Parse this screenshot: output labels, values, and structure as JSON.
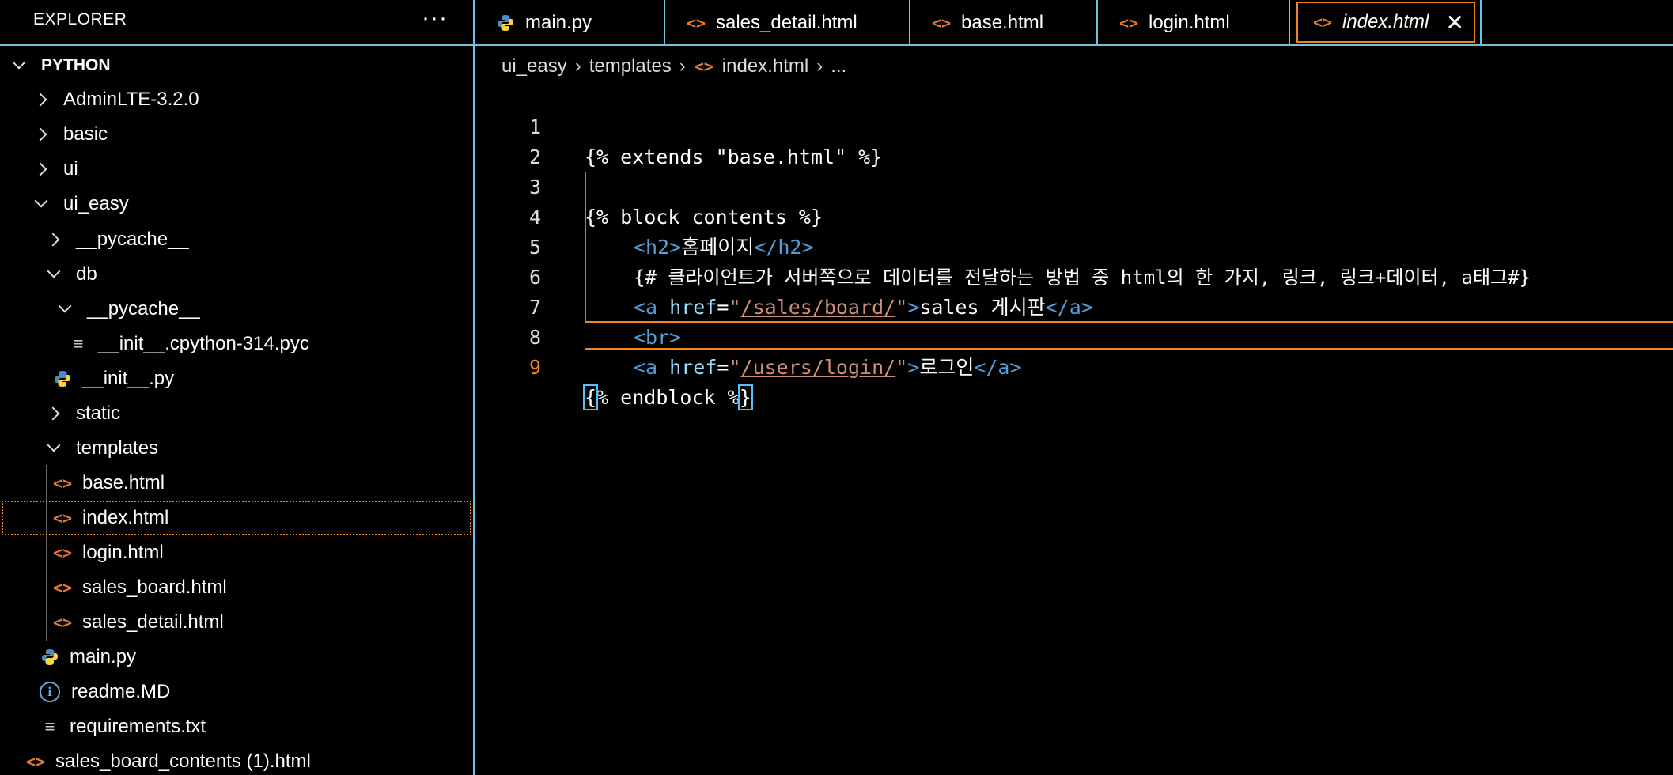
{
  "sidebar": {
    "title": "EXPLORER",
    "more": "···",
    "section": "PYTHON",
    "items": [
      {
        "label": "AdminLTE-3.2.0"
      },
      {
        "label": "basic"
      },
      {
        "label": "ui"
      },
      {
        "label": "ui_easy"
      },
      {
        "label": "__pycache__"
      },
      {
        "label": "db"
      },
      {
        "label": "__pycache__"
      },
      {
        "label": "__init__.cpython-314.pyc"
      },
      {
        "label": "__init__.py"
      },
      {
        "label": "static"
      },
      {
        "label": "templates"
      },
      {
        "label": "base.html"
      },
      {
        "label": "index.html"
      },
      {
        "label": "login.html"
      },
      {
        "label": "sales_board.html"
      },
      {
        "label": "sales_detail.html"
      },
      {
        "label": "main.py"
      },
      {
        "label": "readme.MD"
      },
      {
        "label": "requirements.txt"
      },
      {
        "label": "sales_board_contents (1).html"
      }
    ]
  },
  "tabs": [
    {
      "label": "main.py"
    },
    {
      "label": "sales_detail.html"
    },
    {
      "label": "base.html"
    },
    {
      "label": "login.html"
    },
    {
      "label": "index.html",
      "close": "✕"
    }
  ],
  "breadcrumb": {
    "parts": [
      "ui_easy",
      "templates",
      "index.html",
      "..."
    ]
  },
  "editor": {
    "line_numbers": [
      "1",
      "2",
      "3",
      "4",
      "5",
      "6",
      "7",
      "8",
      "9"
    ],
    "line1": "{% extends \"base.html\" %}",
    "line3": "{% block contents %}",
    "line4": {
      "open": "<h2>",
      "text": "홈페이지",
      "close": "</h2>"
    },
    "line5": "{# 클라이언트가 서버쪽으로 데이터를 전달하는 방법 중 html의 한 가지, 링크, 링크+데이터, a태그#}",
    "line6": {
      "open": "<a",
      "attr": "href",
      "eq": "=",
      "q": "\"",
      "url": "/sales/board/",
      "close_gt": ">",
      "text": "sales 게시판",
      "close": "</a>"
    },
    "line7": "<br>",
    "line8": {
      "open": "<a",
      "attr": "href",
      "eq": "=",
      "q": "\"",
      "url": "/users/login/",
      "close_gt": ">",
      "text": "로그인",
      "close": "</a>"
    },
    "line9": {
      "b1": "{",
      "mid": "% endblock %",
      "b2": "}"
    }
  },
  "colors": {
    "accent": "#f38518",
    "border": "#6fc3df",
    "tag": "#569cd6",
    "string": "#ce9178",
    "attr": "#9cdcfe"
  }
}
